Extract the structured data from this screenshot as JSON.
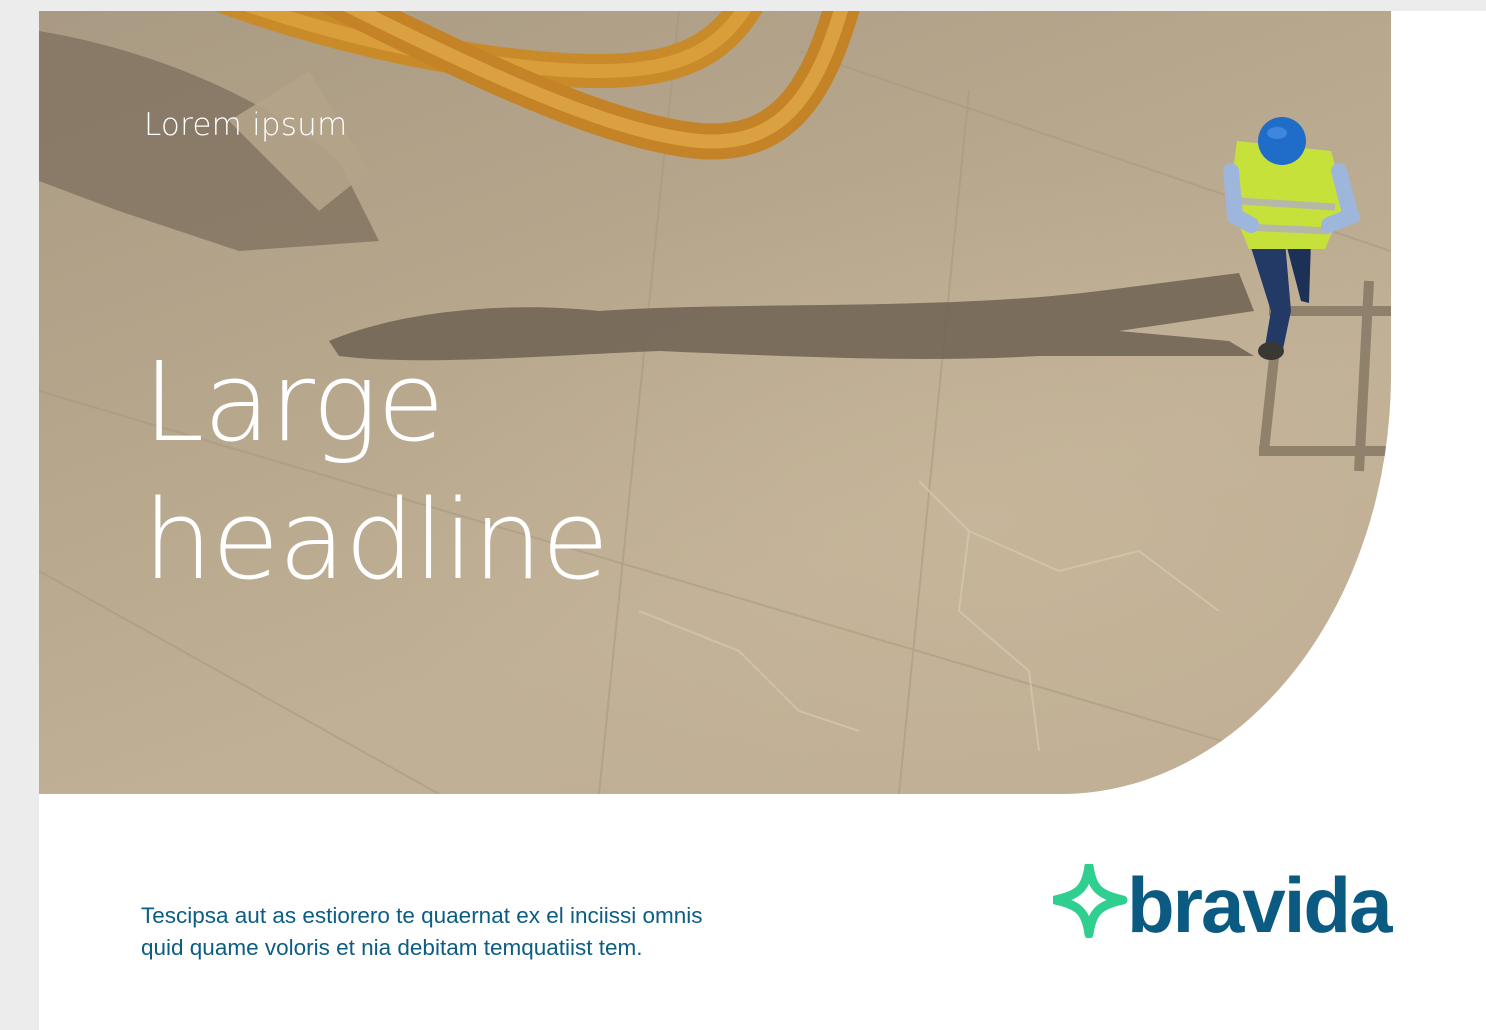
{
  "hero": {
    "eyebrow": "Lorem ipsum",
    "headline_line1": "Large",
    "headline_line2": "headline"
  },
  "footer": {
    "body_line1": "Tescipsa aut as estiorero te quaernat ex el inciissi omnis",
    "body_line2": "quid quame voloris et nia debitam temquatiist tem."
  },
  "logo": {
    "wordmark": "bravida",
    "brand_color": "#0a5a82",
    "accent_color": "#2fd08f"
  },
  "colors": {
    "text_blue": "#0c5d84",
    "page_background": "#ffffff",
    "canvas_background": "#ececec"
  }
}
